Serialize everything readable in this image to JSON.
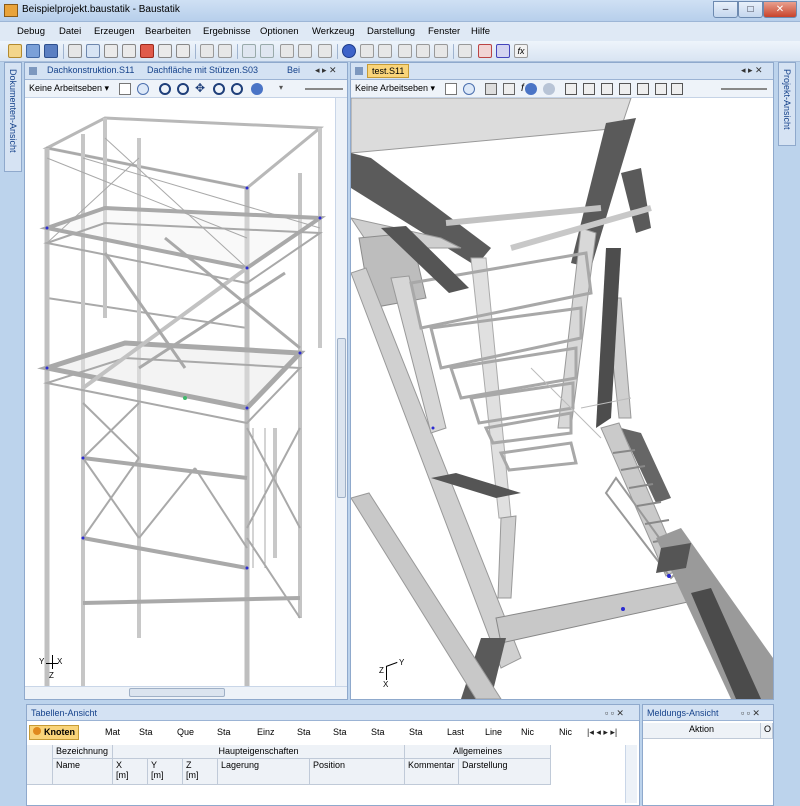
{
  "window": {
    "title": "Beispielprojekt.baustatik - Baustatik",
    "controls": [
      "–",
      "□",
      "✕"
    ]
  },
  "menu": [
    "Debug",
    "Datei",
    "Erzeugen",
    "Bearbeiten",
    "Ergebnisse",
    "Optionen",
    "Werkzeug",
    "Darstellung",
    "Fenster",
    "Hilfe"
  ],
  "side": {
    "left": "Dokumenten-Ansicht",
    "right": "Projekt-Ansicht"
  },
  "left_pane": {
    "tabs": [
      "Dachkonstruktion.S11",
      "Dachfläche mit Stützen.S03",
      "Bei"
    ],
    "workplane": "Keine Arbeitseben ▾",
    "axes": {
      "x": "X",
      "y": "Y",
      "z": "Z"
    }
  },
  "right_pane": {
    "tab": "test.S11",
    "workplane": "Keine Arbeitseben ▾",
    "axes": {
      "x": "X",
      "y": "Y",
      "z": "Z"
    }
  },
  "table_panel": {
    "title": "Tabellen-Ansicht",
    "tabs": [
      "Knoten",
      "Mat",
      "Sta",
      "Que",
      "Sta",
      "Einz",
      "Sta",
      "Sta",
      "Sta",
      "Sta",
      "Last",
      "Line",
      "Nic",
      "Nic"
    ],
    "group_headers": [
      "Bezeichnung",
      "Haupteigenschaften",
      "Allgemeines"
    ],
    "columns": [
      "Name",
      "X",
      "Y",
      "Z",
      "Lagerung",
      "Position",
      "Kommentar",
      "Darstellung"
    ],
    "units": [
      "[m]",
      "[m]",
      "[m]"
    ]
  },
  "message_panel": {
    "title": "Meldungs-Ansicht",
    "column": "Aktion",
    "column2": "O"
  },
  "colors": {
    "accent": "#f9d47a",
    "chrome": "#bcd3ec",
    "steel_light": "#d4d4d4",
    "steel_dark": "#555555"
  }
}
